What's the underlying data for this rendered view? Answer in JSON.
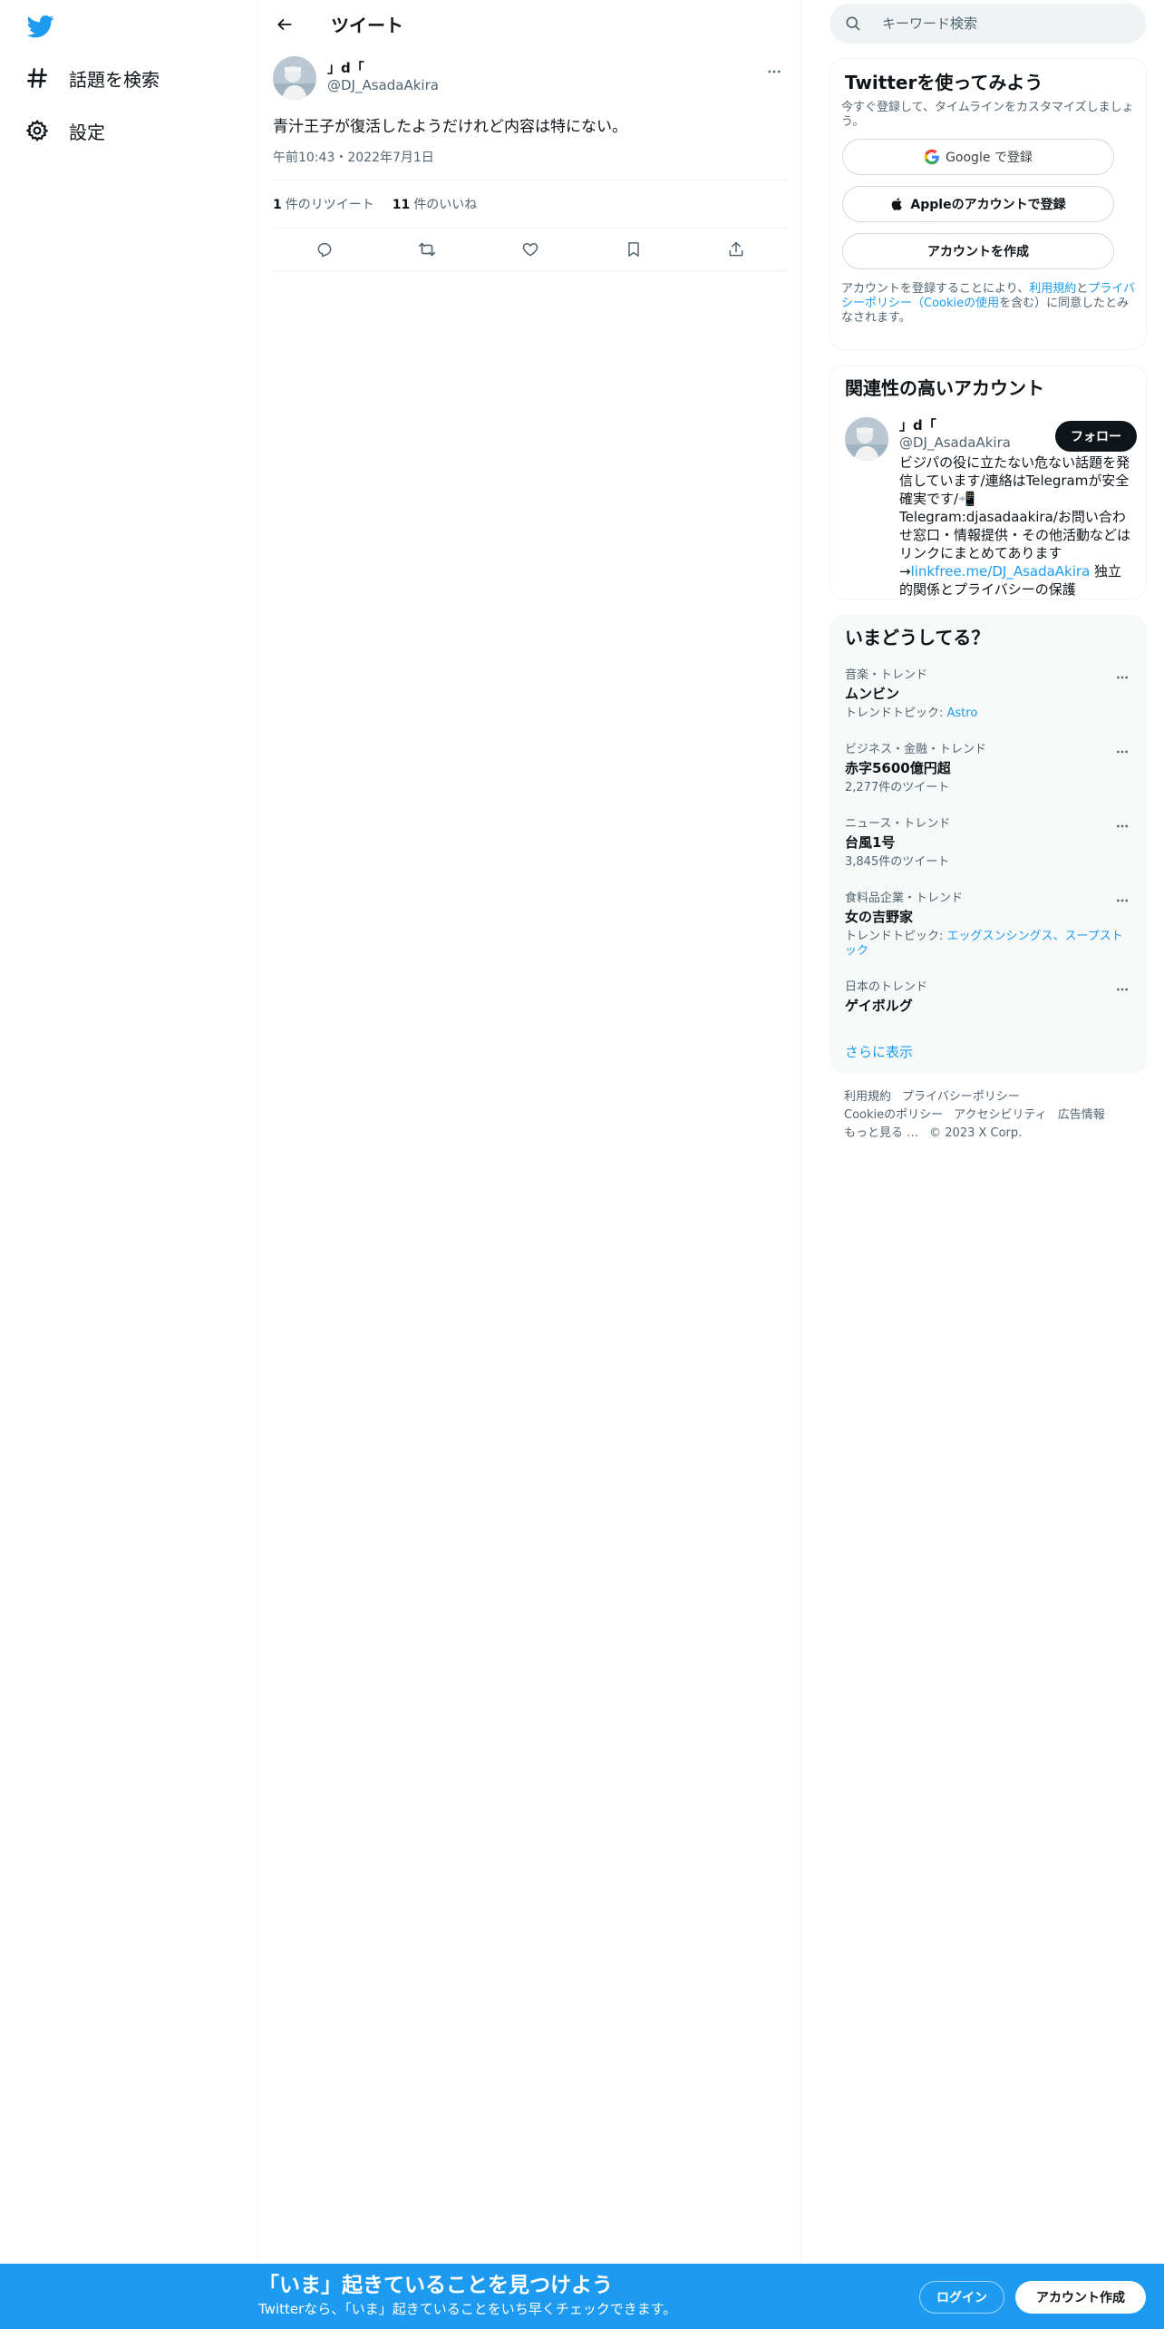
{
  "nav": {
    "logo": "twitter-bird-icon",
    "items": [
      {
        "label": "話題を検索",
        "icon": "hashtag-icon"
      },
      {
        "label": "設定",
        "icon": "gear-icon"
      }
    ]
  },
  "header": {
    "title": "ツイート"
  },
  "tweet": {
    "author_name": "」d「",
    "author_handle": "@DJ_AsadaAkira",
    "text": "青汁王子が復活したようだけれど内容は特にない。",
    "timestamp": "午前10:43・2022年7月1日",
    "retweets_count": "1",
    "retweets_label": "件のリツイート",
    "likes_count": "11",
    "likes_label": "件のいいね"
  },
  "search": {
    "placeholder": "キーワード検索"
  },
  "signup": {
    "title": "Twitterを使ってみよう",
    "subtitle": "今すぐ登録して、タイムラインをカスタマイズしましょう。",
    "google_label": "Google で登録",
    "apple_label": "Appleのアカウントで登録",
    "create_label": "アカウントを作成",
    "terms_prefix": "アカウントを登録することにより、",
    "terms_link1": "利用規約",
    "terms_mid": "と",
    "terms_link2": "プライバシーポリシー（Cookieの使用",
    "terms_suffix": "を含む）に同意したとみなされます。"
  },
  "related": {
    "title": "関連性の高いアカウント",
    "name": "」d「",
    "handle": "@DJ_AsadaAkira",
    "follow_label": "フォロー",
    "bio_prefix": "ビジパの役に立たない危ない話題を発信しています/連絡はTelegramが安全確実です/📲Telegram:djasadaakira/お問い合わせ窓口・情報提供・その他活動などはリンクにまとめてあります→",
    "bio_link": "linkfree.me/DJ_AsadaAkira",
    "bio_suffix": " 独立的関係とプライバシーの保護"
  },
  "trends": {
    "title": "いまどうしてる？",
    "items": [
      {
        "meta": "音楽・トレンド",
        "name": "ムンビン",
        "sub_prefix": "トレンドトピック: ",
        "sub_link": "Astro",
        "sub": ""
      },
      {
        "meta": "ビジネス・金融・トレンド",
        "name": "赤字5600億円超",
        "sub_prefix": "",
        "sub_link": "",
        "sub": "2,277件のツイート"
      },
      {
        "meta": "ニュース・トレンド",
        "name": "台風1号",
        "sub_prefix": "",
        "sub_link": "",
        "sub": "3,845件のツイート"
      },
      {
        "meta": "食料品企業・トレンド",
        "name": "女の吉野家",
        "sub_prefix": "トレンドトピック: ",
        "sub_link": "エッグスンシングス、スープストック",
        "sub": ""
      },
      {
        "meta": "日本のトレンド",
        "name": "ゲイボルグ",
        "sub_prefix": "",
        "sub_link": "",
        "sub": ""
      }
    ],
    "show_more": "さらに表示"
  },
  "footer": {
    "links": [
      "利用規約",
      "プライバシーポリシー",
      "Cookieのポリシー",
      "アクセシビリティ",
      "広告情報",
      "もっと見る …",
      "© 2023 X Corp."
    ]
  },
  "bottom_bar": {
    "title": "「いま」起きていることを見つけよう",
    "subtitle": "Twitterなら、「いま」起きていることをいち早くチェックできます。",
    "login_label": "ログイン",
    "signup_label": "アカウント作成"
  },
  "colors": {
    "accent": "#1d9bf0",
    "text_primary": "#0f1419",
    "text_secondary": "#536471"
  }
}
